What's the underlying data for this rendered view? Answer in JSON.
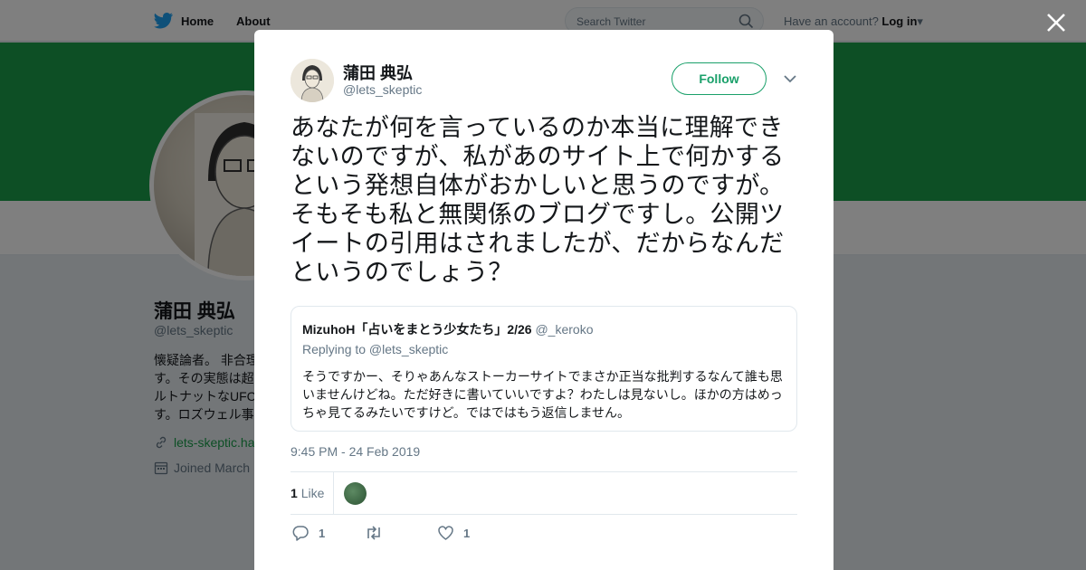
{
  "topbar": {
    "home_label": "Home",
    "about_label": "About",
    "search_placeholder": "Search Twitter",
    "account_prompt": "Have an account?",
    "login_label": "Log in"
  },
  "profile": {
    "name": "蒲田 典弘",
    "handle": "@lets_skeptic",
    "bio_lines": [
      "懐疑論者。 非合理",
      "す。その実態は超",
      "ルトナットなUFC",
      "す。ロズウェル事"
    ],
    "link": "lets-skeptic.ha",
    "joined": "Joined March"
  },
  "tweet": {
    "author_name": "蒲田 典弘",
    "author_handle": "@lets_skeptic",
    "follow_label": "Follow",
    "text": "あなたが何を言っているのか本当に理解できないのですが、私があのサイト上で何かするという発想自体がおかしいと思うのですが。そもそも私と無関係のブログですし。公開ツイートの引用はされましたが、だからなんだというのでしょう？",
    "timestamp": "9:45 PM - 24 Feb 2019",
    "like_count": "1",
    "like_label": "Like",
    "reply_count": "1",
    "retweet_count": "",
    "favorite_count": "1"
  },
  "quote": {
    "author_name": "MizuhoH「占いをまとう少女たち」2/26",
    "author_handle": "@_keroko",
    "replying_to": "Replying to @lets_skeptic",
    "text": "そうですかー、そりゃあんなストーカーサイトでまさか正当な批判するなんて誰も思いませんけどね。ただ好きに書いていいですよ？わたしは見ないし。ほかの方はめっちゃ見てるみたいですけど。ではではもう返信しません。"
  },
  "colors": {
    "brand_green": "#1aa06a",
    "banner_green": "#1a9e4b",
    "text_secondary": "#657786"
  }
}
